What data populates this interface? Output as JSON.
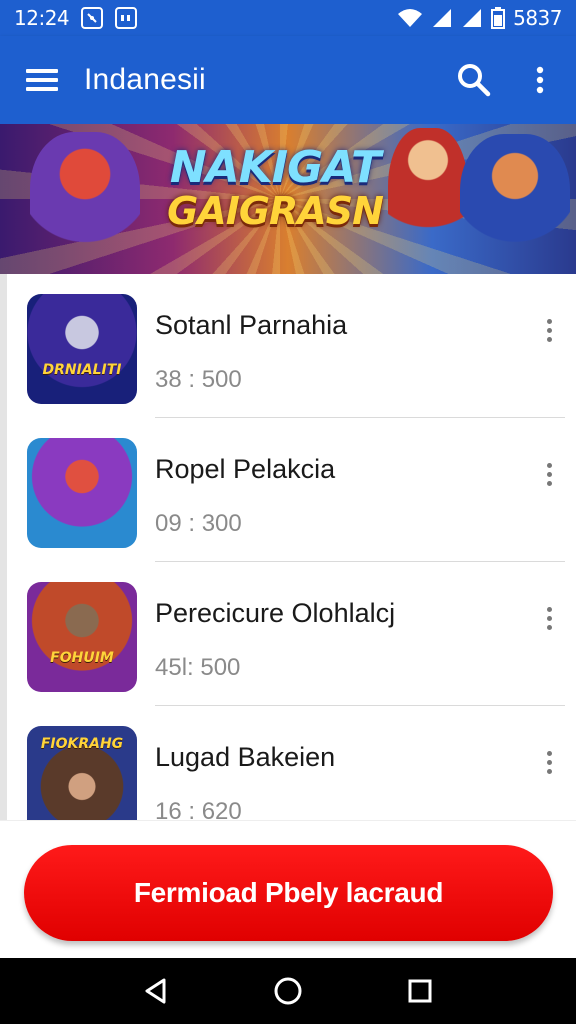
{
  "status_bar": {
    "time": "12:24",
    "battery_text": "5837",
    "icons": [
      "notification-icon",
      "media-icon",
      "wifi-icon",
      "signal-icon",
      "signal-icon",
      "battery-icon"
    ]
  },
  "app_bar": {
    "title": "Indanesii",
    "menu_icon": "hamburger-menu-icon",
    "search_icon": "search-icon",
    "more_icon": "more-vert-icon"
  },
  "banner": {
    "line1": "NAKIGAT",
    "line2": "GAIGRASN"
  },
  "games": [
    {
      "title": "Sotanl Parnahia",
      "meta": "38 : 500",
      "thumb_label": "DRNIALITI"
    },
    {
      "title": "Ropel Pelakcia",
      "meta": "09 : 300",
      "thumb_label": ""
    },
    {
      "title": "Perecicure Olohlalcj",
      "meta": "45l: 500",
      "thumb_label": "FOHUIM"
    },
    {
      "title": "Lugad Bakeien",
      "meta": "16 : 620",
      "thumb_label": "FIOKRAHG"
    }
  ],
  "download_button": {
    "label": "Fermioad Pbely lacraud"
  },
  "colors": {
    "primary": "#1e5fcf",
    "accent": "#e00000",
    "nav_bar": "#000000"
  }
}
